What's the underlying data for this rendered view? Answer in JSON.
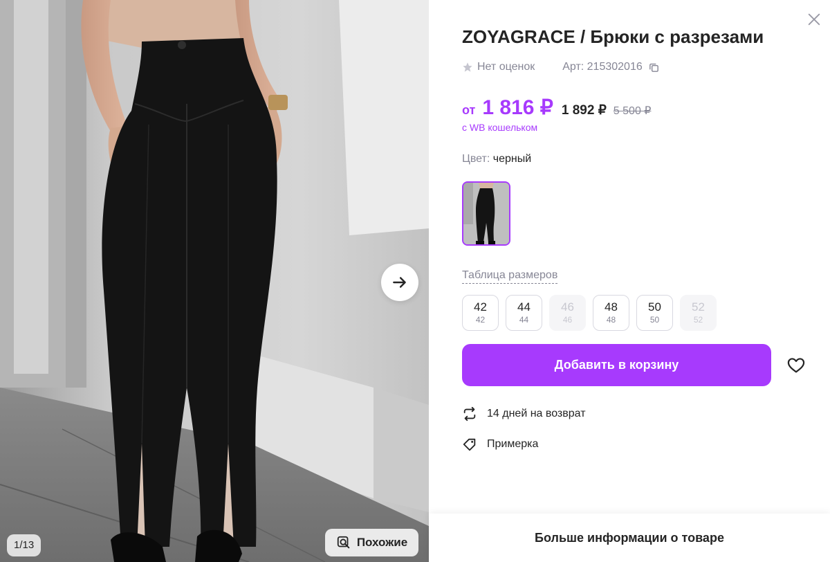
{
  "gallery": {
    "counter": "1/13",
    "similar_label": "Похожие"
  },
  "product": {
    "title": "ZOYAGRACE / Брюки с разрезами",
    "rating_text": "Нет оценок",
    "article": "Арт: 215302016",
    "price_from": "от",
    "price_wallet": "1 816 ₽",
    "price_regular": "1 892 ₽",
    "price_old": "5 500 ₽",
    "wallet_note": "с WB кошельком",
    "color_key": "Цвет:",
    "color_value": "черный"
  },
  "sizes": {
    "table_link": "Таблица размеров",
    "items": [
      {
        "size": "42",
        "ru": "42",
        "available": true
      },
      {
        "size": "44",
        "ru": "44",
        "available": true
      },
      {
        "size": "46",
        "ru": "46",
        "available": false
      },
      {
        "size": "48",
        "ru": "48",
        "available": true
      },
      {
        "size": "50",
        "ru": "50",
        "available": true
      },
      {
        "size": "52",
        "ru": "52",
        "available": false
      }
    ]
  },
  "actions": {
    "add_to_cart": "Добавить в корзину",
    "more_info": "Больше информации о товаре"
  },
  "features": {
    "return_text": "14 дней на возврат",
    "fitting_text": "Примерка"
  },
  "colors": {
    "accent": "#a73afd",
    "muted": "#868695",
    "text": "#242424"
  },
  "icons": [
    "arrow-right-icon",
    "search-similar-icon",
    "close-icon",
    "star-icon",
    "copy-icon",
    "heart-icon",
    "return-icon",
    "tag-icon"
  ]
}
